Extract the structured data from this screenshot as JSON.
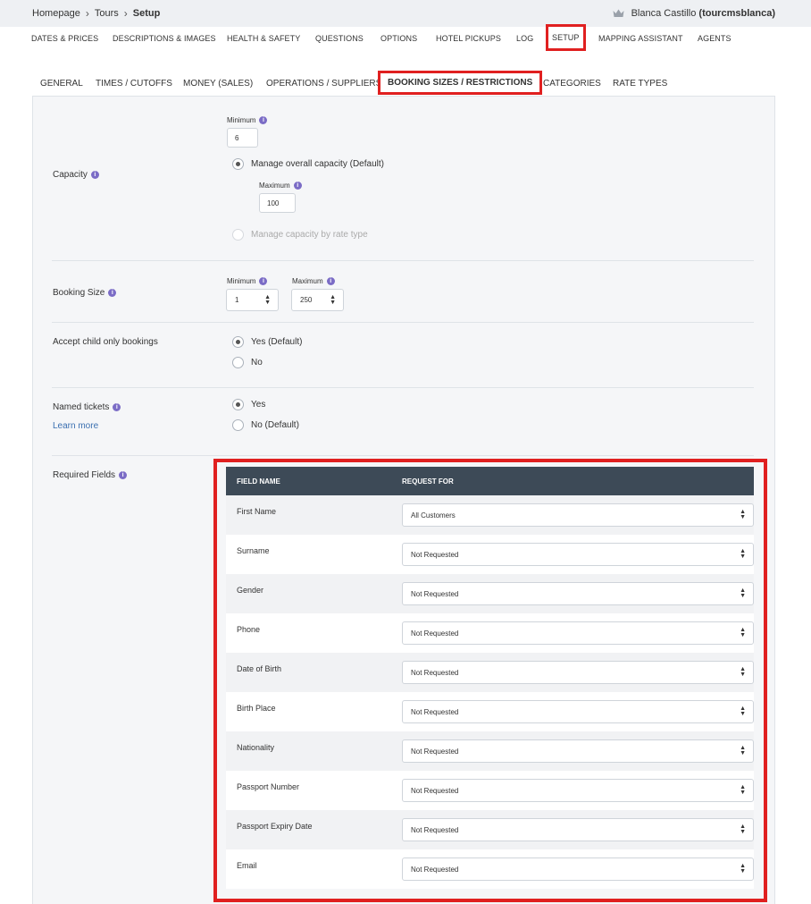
{
  "breadcrumb": {
    "items": [
      "Homepage",
      "Tours"
    ],
    "current": "Setup"
  },
  "user": {
    "name": "Blanca Castillo",
    "username": "(tourcmsblanca)",
    "icon": "crown-icon"
  },
  "main_nav": [
    "DATES & PRICES",
    "DESCRIPTIONS & IMAGES",
    "HEALTH & SAFETY",
    "QUESTIONS",
    "OPTIONS",
    "HOTEL PICKUPS",
    "LOG",
    "SETUP",
    "MAPPING ASSISTANT",
    "AGENTS"
  ],
  "main_nav_active": "SETUP",
  "sub_tabs": [
    "GENERAL",
    "TIMES / CUTOFFS",
    "MONEY (SALES)",
    "OPERATIONS / SUPPLIERS",
    "BOOKING SIZES / RESTRICTIONS",
    "CATEGORIES",
    "RATE TYPES"
  ],
  "sub_tab_active": "BOOKING SIZES / RESTRICTIONS",
  "capacity": {
    "label": "Capacity",
    "minimum_label": "Minimum",
    "minimum_value": "6",
    "option_overall": "Manage overall capacity (Default)",
    "maximum_label": "Maximum",
    "maximum_value": "100",
    "option_rate_type": "Manage capacity by rate type"
  },
  "booking_size": {
    "label": "Booking Size",
    "minimum_label": "Minimum",
    "minimum_value": "1",
    "maximum_label": "Maximum",
    "maximum_value": "250"
  },
  "child_only": {
    "label": "Accept child only bookings",
    "option_yes": "Yes (Default)",
    "option_no": "No"
  },
  "named_tickets": {
    "label": "Named tickets",
    "learn_more": "Learn more",
    "option_yes": "Yes",
    "option_no": "No (Default)"
  },
  "required_fields": {
    "label": "Required Fields",
    "col_field": "FIELD NAME",
    "col_request": "REQUEST FOR",
    "rows": [
      {
        "field": "First Name",
        "request": "All Customers"
      },
      {
        "field": "Surname",
        "request": "Not Requested"
      },
      {
        "field": "Gender",
        "request": "Not Requested"
      },
      {
        "field": "Phone",
        "request": "Not Requested"
      },
      {
        "field": "Date of Birth",
        "request": "Not Requested"
      },
      {
        "field": "Birth Place",
        "request": "Not Requested"
      },
      {
        "field": "Nationality",
        "request": "Not Requested"
      },
      {
        "field": "Passport Number",
        "request": "Not Requested"
      },
      {
        "field": "Passport Expiry Date",
        "request": "Not Requested"
      },
      {
        "field": "Email",
        "request": "Not Requested"
      }
    ]
  },
  "colors": {
    "highlight": "#e02020",
    "table_header": "#3d4a57",
    "info_icon": "#7b6cc6",
    "link": "#3a6fb0"
  }
}
